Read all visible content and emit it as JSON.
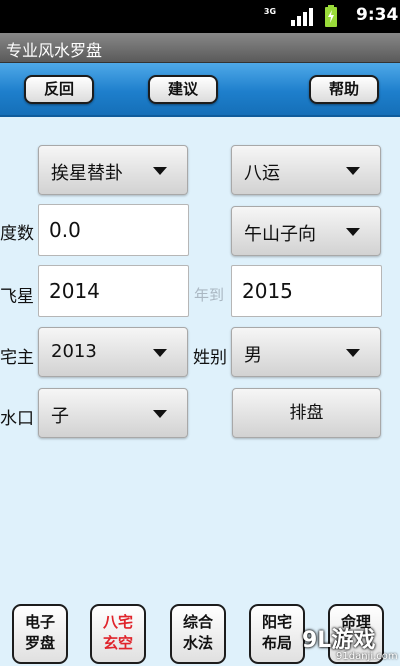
{
  "status_bar": {
    "network": "3G",
    "time": "9:34"
  },
  "app_title": "专业风水罗盘",
  "toolbar": {
    "back": "反回",
    "suggest": "建议",
    "help": "帮助"
  },
  "form": {
    "method_select": "挨星替卦",
    "period_select": "八运",
    "degree_label": "度数",
    "degree_value": "0.0",
    "direction_select": "午山子向",
    "flying_star_label": "飞星",
    "start_year": "2014",
    "to_label": "年到",
    "end_year": "2015",
    "owner_label": "宅主",
    "owner_year": "2013",
    "gender_label": "姓别",
    "gender_value": "男",
    "water_label": "水口",
    "water_value": "子",
    "arrange_button": "排盘"
  },
  "bottom_tabs": [
    {
      "line1": "电子",
      "line2": "罗盘"
    },
    {
      "line1": "八宅",
      "line2": "玄空"
    },
    {
      "line1": "综合",
      "line2": "水法"
    },
    {
      "line1": "阳宅",
      "line2": "布局"
    },
    {
      "line1": "命理",
      "line2": ""
    }
  ],
  "watermark": {
    "logo": "9L游戏",
    "site": "91danji.com"
  },
  "colors": {
    "toolbar": "#1e7fcc",
    "background": "#dff1fb",
    "active_tab_text": "#e0242b"
  }
}
